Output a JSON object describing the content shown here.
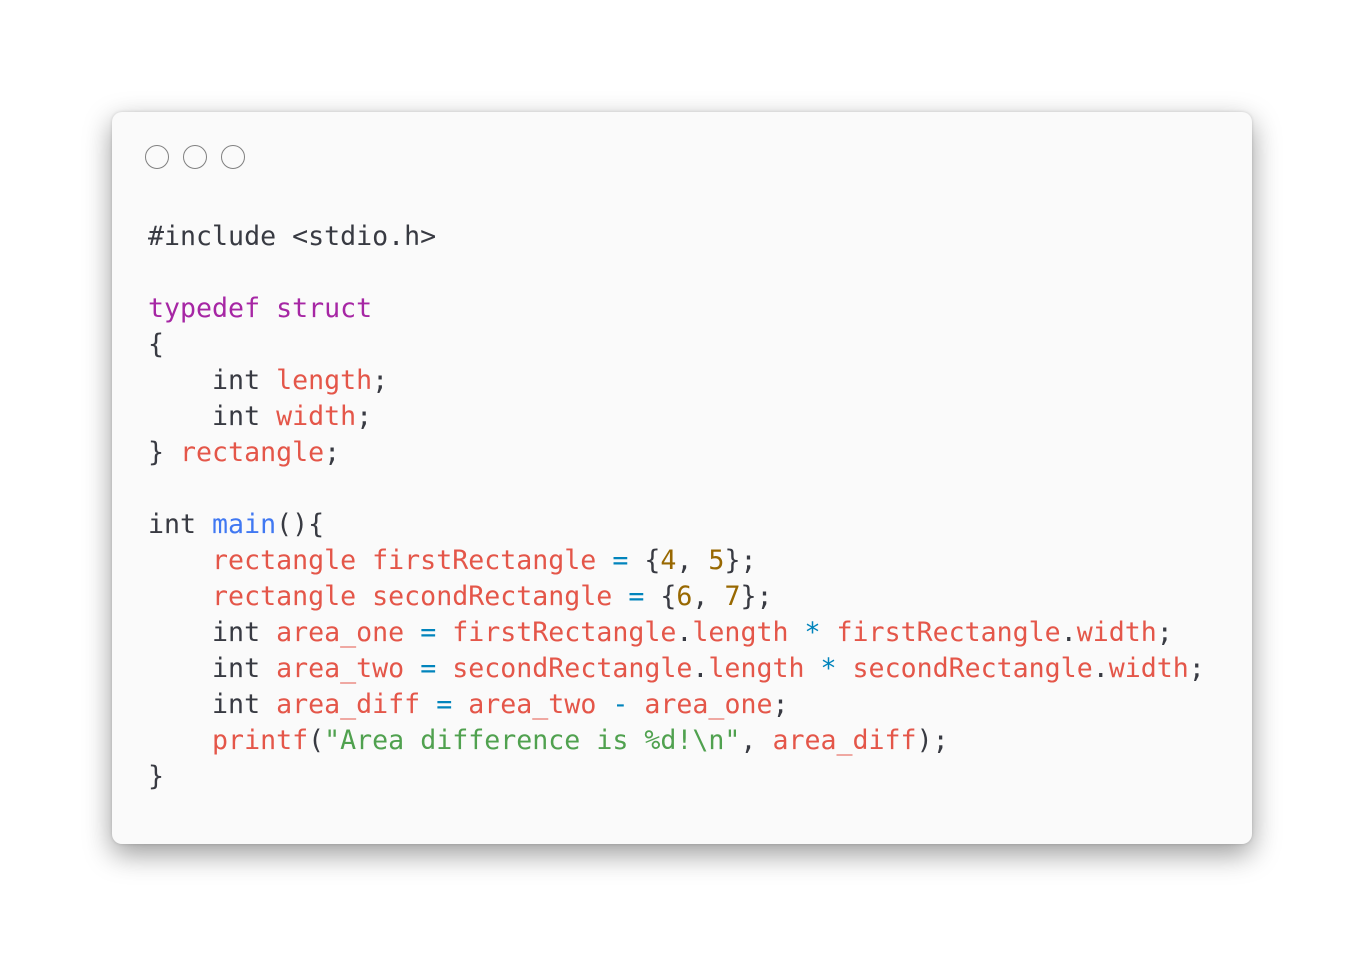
{
  "window": {
    "controls": [
      "close-dot",
      "minimize-dot",
      "maximize-dot"
    ]
  },
  "colors": {
    "keyword": "#a626a4",
    "identifier": "#e45649",
    "function": "#4078f2",
    "number": "#986801",
    "operator": "#0184bc",
    "string": "#50a14f",
    "plain": "#383a42"
  },
  "code": {
    "lines": [
      [
        {
          "t": "#include <stdio.h>",
          "c": "pl"
        }
      ],
      [],
      [
        {
          "t": "typedef",
          "c": "kw"
        },
        {
          "t": " ",
          "c": "pl"
        },
        {
          "t": "struct",
          "c": "kw"
        }
      ],
      [
        {
          "t": "{",
          "c": "pl"
        }
      ],
      [
        {
          "t": "    int ",
          "c": "ty"
        },
        {
          "t": "length",
          "c": "var"
        },
        {
          "t": ";",
          "c": "pl"
        }
      ],
      [
        {
          "t": "    int ",
          "c": "ty"
        },
        {
          "t": "width",
          "c": "var"
        },
        {
          "t": ";",
          "c": "pl"
        }
      ],
      [
        {
          "t": "} ",
          "c": "pl"
        },
        {
          "t": "rectangle",
          "c": "var"
        },
        {
          "t": ";",
          "c": "pl"
        }
      ],
      [],
      [
        {
          "t": "int ",
          "c": "ty"
        },
        {
          "t": "main",
          "c": "fn"
        },
        {
          "t": "(){",
          "c": "pl"
        }
      ],
      [
        {
          "t": "    ",
          "c": "pl"
        },
        {
          "t": "rectangle firstRectangle",
          "c": "var"
        },
        {
          "t": " ",
          "c": "pl"
        },
        {
          "t": "=",
          "c": "op"
        },
        {
          "t": " {",
          "c": "pl"
        },
        {
          "t": "4",
          "c": "num"
        },
        {
          "t": ", ",
          "c": "pl"
        },
        {
          "t": "5",
          "c": "num"
        },
        {
          "t": "};",
          "c": "pl"
        }
      ],
      [
        {
          "t": "    ",
          "c": "pl"
        },
        {
          "t": "rectangle secondRectangle",
          "c": "var"
        },
        {
          "t": " ",
          "c": "pl"
        },
        {
          "t": "=",
          "c": "op"
        },
        {
          "t": " {",
          "c": "pl"
        },
        {
          "t": "6",
          "c": "num"
        },
        {
          "t": ", ",
          "c": "pl"
        },
        {
          "t": "7",
          "c": "num"
        },
        {
          "t": "};",
          "c": "pl"
        }
      ],
      [
        {
          "t": "    int ",
          "c": "ty"
        },
        {
          "t": "area_one",
          "c": "var"
        },
        {
          "t": " ",
          "c": "pl"
        },
        {
          "t": "=",
          "c": "op"
        },
        {
          "t": " ",
          "c": "pl"
        },
        {
          "t": "firstRectangle",
          "c": "var"
        },
        {
          "t": ".",
          "c": "pl"
        },
        {
          "t": "length",
          "c": "var"
        },
        {
          "t": " ",
          "c": "pl"
        },
        {
          "t": "*",
          "c": "op"
        },
        {
          "t": " ",
          "c": "pl"
        },
        {
          "t": "firstRectangle",
          "c": "var"
        },
        {
          "t": ".",
          "c": "pl"
        },
        {
          "t": "width",
          "c": "var"
        },
        {
          "t": ";",
          "c": "pl"
        }
      ],
      [
        {
          "t": "    int ",
          "c": "ty"
        },
        {
          "t": "area_two",
          "c": "var"
        },
        {
          "t": " ",
          "c": "pl"
        },
        {
          "t": "=",
          "c": "op"
        },
        {
          "t": " ",
          "c": "pl"
        },
        {
          "t": "secondRectangle",
          "c": "var"
        },
        {
          "t": ".",
          "c": "pl"
        },
        {
          "t": "length",
          "c": "var"
        },
        {
          "t": " ",
          "c": "pl"
        },
        {
          "t": "*",
          "c": "op"
        },
        {
          "t": " ",
          "c": "pl"
        },
        {
          "t": "secondRectangle",
          "c": "var"
        },
        {
          "t": ".",
          "c": "pl"
        },
        {
          "t": "width",
          "c": "var"
        },
        {
          "t": ";",
          "c": "pl"
        }
      ],
      [
        {
          "t": "    int ",
          "c": "ty"
        },
        {
          "t": "area_diff",
          "c": "var"
        },
        {
          "t": " ",
          "c": "pl"
        },
        {
          "t": "=",
          "c": "op"
        },
        {
          "t": " ",
          "c": "pl"
        },
        {
          "t": "area_two",
          "c": "var"
        },
        {
          "t": " ",
          "c": "pl"
        },
        {
          "t": "-",
          "c": "op"
        },
        {
          "t": " ",
          "c": "pl"
        },
        {
          "t": "area_one",
          "c": "var"
        },
        {
          "t": ";",
          "c": "pl"
        }
      ],
      [
        {
          "t": "    ",
          "c": "pl"
        },
        {
          "t": "printf",
          "c": "var"
        },
        {
          "t": "(",
          "c": "pl"
        },
        {
          "t": "\"Area difference is %d!\\n\"",
          "c": "str"
        },
        {
          "t": ", ",
          "c": "pl"
        },
        {
          "t": "area_diff",
          "c": "var"
        },
        {
          "t": ");",
          "c": "pl"
        }
      ],
      [
        {
          "t": "}",
          "c": "pl"
        }
      ]
    ]
  }
}
